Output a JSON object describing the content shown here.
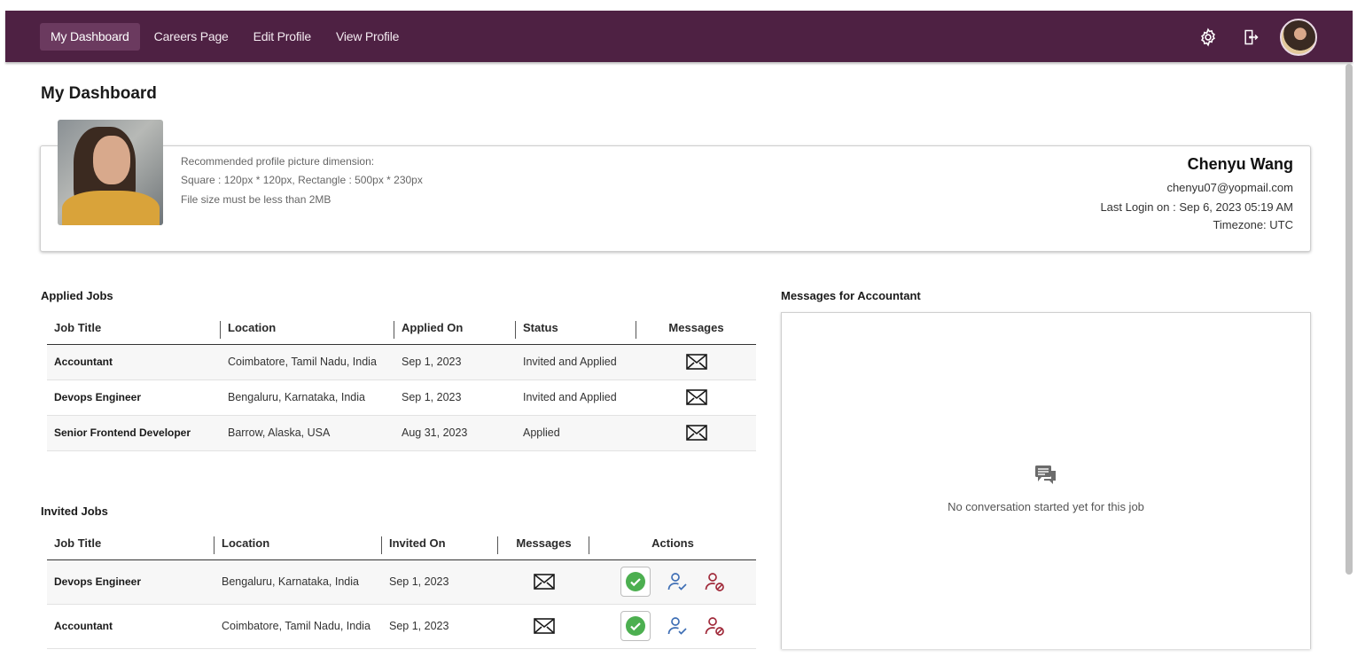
{
  "nav": {
    "items": [
      {
        "label": "My Dashboard",
        "active": true
      },
      {
        "label": "Careers Page",
        "active": false
      },
      {
        "label": "Edit Profile",
        "active": false
      },
      {
        "label": "View Profile",
        "active": false
      }
    ],
    "icons": [
      "gear-icon",
      "logout-icon",
      "avatar"
    ],
    "color": "#4e2143"
  },
  "page": {
    "title": "My Dashboard"
  },
  "profile": {
    "hint_1": "Recommended profile picture dimension:",
    "hint_2": "Square : 120px * 120px, Rectangle : 500px * 230px",
    "hint_3": "File size must be less than 2MB",
    "name": "Chenyu Wang",
    "email": "chenyu07@yopmail.com",
    "last_login": "Last Login on : Sep 6, 2023 05:19 AM",
    "timezone": "Timezone: UTC"
  },
  "applied_jobs": {
    "title": "Applied Jobs",
    "headers": [
      "Job Title",
      "Location",
      "Applied On",
      "Status",
      "Messages"
    ],
    "rows": [
      {
        "job_title": "Accountant",
        "location": "Coimbatore, Tamil Nadu, India",
        "date": "Sep 1, 2023",
        "status": "Invited and Applied"
      },
      {
        "job_title": "Devops Engineer",
        "location": "Bengaluru, Karnataka, India",
        "date": "Sep 1, 2023",
        "status": "Invited and Applied"
      },
      {
        "job_title": "Senior Frontend Developer",
        "location": "Barrow, Alaska, USA",
        "date": "Aug 31, 2023",
        "status": "Applied"
      }
    ]
  },
  "invited_jobs": {
    "title": "Invited Jobs",
    "headers": [
      "Job Title",
      "Location",
      "Invited On",
      "Messages",
      "Actions"
    ],
    "rows": [
      {
        "job_title": "Devops Engineer",
        "location": "Bengaluru, Karnataka, India",
        "date": "Sep 1, 2023"
      },
      {
        "job_title": "Accountant",
        "location": "Coimbatore, Tamil Nadu, India",
        "date": "Sep 1, 2023"
      }
    ]
  },
  "messages": {
    "title": "Messages for Accountant",
    "empty_text": "No conversation started yet for this job"
  },
  "colors": {
    "accept": "#4caf50",
    "person": "#3f6fb5",
    "reject": "#a02a3a"
  }
}
